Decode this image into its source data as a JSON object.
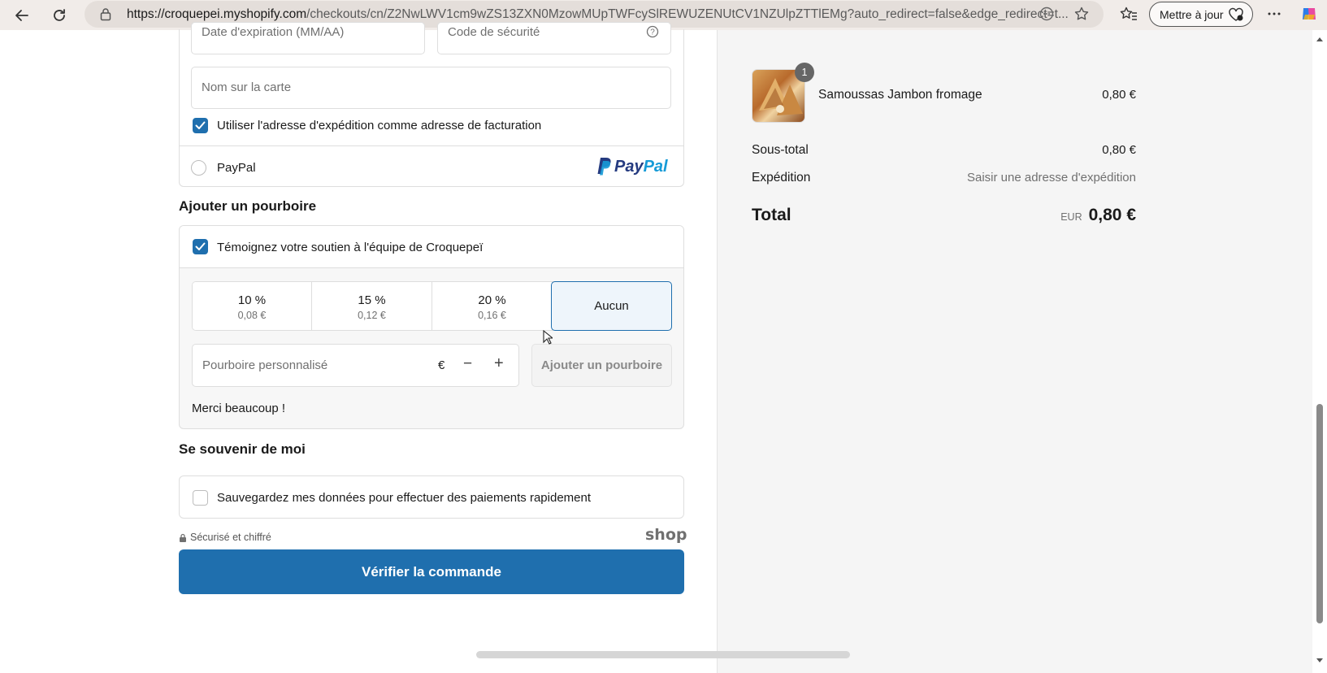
{
  "browser": {
    "url_host": "https://croquepei.myshopify.com",
    "url_path": "/checkouts/cn/Z2NwLWV1cm9wZS13ZXN0MzowMUpTWFcySlREWUZENUtCV1NZUlpZTTlEMg?auto_redirect=false&edge_redirect=t...",
    "update_label": "Mettre à jour",
    "icons": [
      "back-icon",
      "refresh-icon",
      "lock-icon",
      "reader-icon",
      "star-icon",
      "favorites-icon",
      "more-icon",
      "copilot-icon"
    ]
  },
  "payment": {
    "expiry_placeholder": "Date d'expiration (MM/AA)",
    "security_placeholder": "Code de sécurité",
    "name_placeholder": "Nom sur la carte",
    "billing_same_label": "Utiliser l'adresse d'expédition comme adresse de facturation",
    "billing_same_checked": true,
    "paypal_label": "PayPal",
    "paypal_logo_p1": "Pay",
    "paypal_logo_p2": "Pal"
  },
  "tip": {
    "heading": "Ajouter un pourboire",
    "support_label": "Témoignez votre soutien à l'équipe de Croquepeï",
    "support_checked": true,
    "options": [
      {
        "pct": "10 %",
        "amount": "0,08 €"
      },
      {
        "pct": "15 %",
        "amount": "0,12 €"
      },
      {
        "pct": "20 %",
        "amount": "0,16 €"
      }
    ],
    "none_label": "Aucun",
    "custom_placeholder": "Pourboire personnalisé",
    "currency_symbol": "€",
    "minus": "−",
    "plus": "+",
    "add_button": "Ajouter un pourboire",
    "thanks": "Merci beaucoup !"
  },
  "remember": {
    "heading": "Se souvenir de moi",
    "save_label": "Sauvegardez mes données pour effectuer des paiements rapidement",
    "save_checked": false,
    "secure_label": "Sécurisé et chiffré",
    "shop_logo": "shop"
  },
  "submit_label": "Vérifier la commande",
  "summary": {
    "item_qty": "1",
    "item_name": "Samoussas Jambon fromage",
    "item_price": "0,80 €",
    "subtotal_label": "Sous-total",
    "subtotal_value": "0,80 €",
    "shipping_label": "Expédition",
    "shipping_value": "Saisir une adresse d'expédition",
    "total_label": "Total",
    "total_currency": "EUR",
    "total_value": "0,80 €"
  },
  "colors": {
    "accent": "#1f6fae",
    "paypal_dark": "#253b80",
    "paypal_light": "#179bd7",
    "selected_bg": "#eef5fb"
  }
}
